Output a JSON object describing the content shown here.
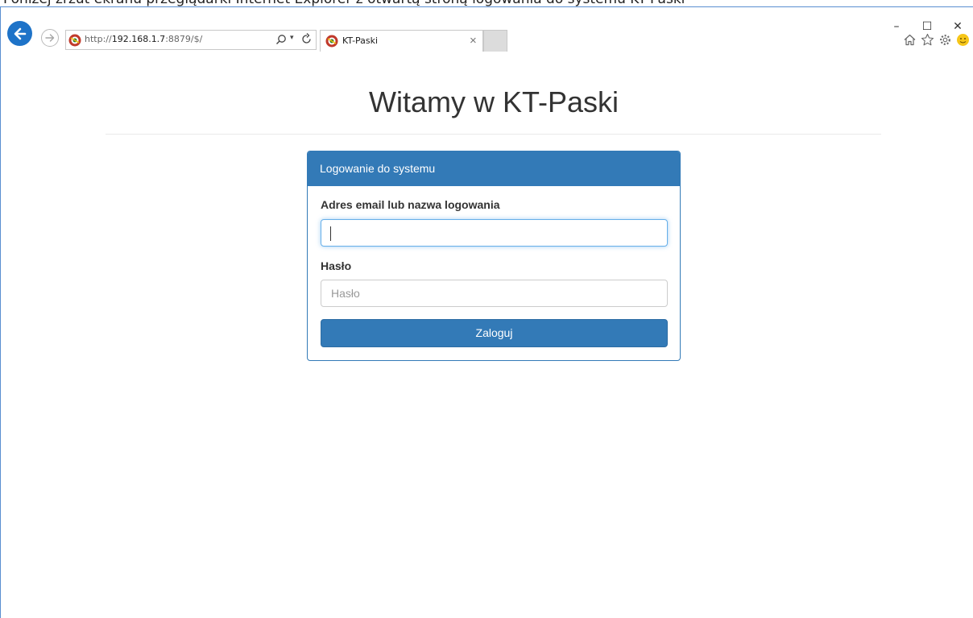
{
  "top_strip_text": "Poniżej zrzut ekranu przeglądarki Internet Explorer z otwartą stroną logowania do systemu KT-Paski",
  "browser": {
    "address": {
      "url_prefix": "http://",
      "url_host": "192.168.1.7",
      "url_rest": ":8879/$/",
      "dropdown_glyph": "▾"
    },
    "tab": {
      "title": "KT-Paski",
      "close_glyph": "×"
    },
    "window_controls": {
      "minimize": "–",
      "maximize": "☐",
      "close": "✕"
    },
    "icons": [
      "back-arrow-icon",
      "forward-arrow-icon",
      "ie-favicon-icon",
      "search-icon",
      "refresh-icon",
      "home-icon",
      "star-icon",
      "gear-icon",
      "smiley-icon"
    ]
  },
  "page": {
    "title": "Witamy w KT-Paski",
    "panel": {
      "heading": "Logowanie do systemu",
      "login_label": "Adres email lub nazwa logowania",
      "login_value": "",
      "password_label": "Hasło",
      "password_placeholder": "Hasło",
      "submit_label": "Zaloguj"
    }
  },
  "colors": {
    "primary": "#337ab7",
    "back_button": "#1e73c8",
    "focus_border": "#66afe9",
    "text": "#333333"
  }
}
